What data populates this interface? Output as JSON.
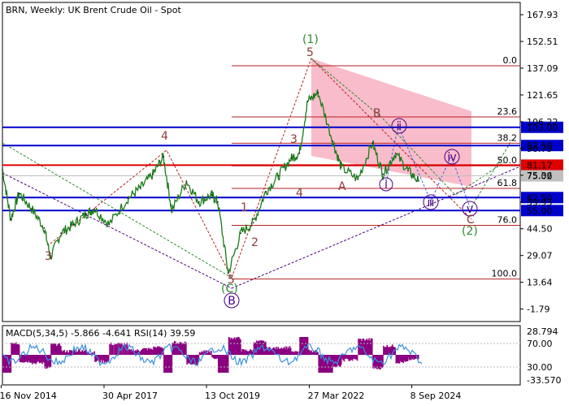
{
  "chart_data": [
    {
      "type": "line",
      "title": "BRN, Weekly:  UK Brent Crude Oil - Spot",
      "y_axis_ticks": [
        "167.93",
        "152.51",
        "137.09",
        "121.65",
        "106.22",
        "90.79",
        "75.36",
        "59.93",
        "44.50",
        "29.07",
        "13.64",
        "-1.79"
      ],
      "x_axis_ticks": [
        "16 Nov 2014",
        "30 Apr 2017",
        "13 Oct 2019",
        "27 Mar 2022",
        "8 Sep 2024"
      ],
      "ylim": [
        -9,
        175
      ],
      "series": [
        {
          "values": [
            [
              2014.9,
              79
            ],
            [
              2015.1,
              50
            ],
            [
              2015.3,
              65
            ],
            [
              2015.6,
              56
            ],
            [
              2015.9,
              45
            ],
            [
              2016.05,
              28
            ],
            [
              2016.3,
              42
            ],
            [
              2016.6,
              47
            ],
            [
              2016.9,
              53
            ],
            [
              2017.1,
              56
            ],
            [
              2017.45,
              47
            ],
            [
              2017.9,
              62
            ],
            [
              2018.2,
              68
            ],
            [
              2018.5,
              76
            ],
            [
              2018.75,
              86
            ],
            [
              2018.95,
              55
            ],
            [
              2019.3,
              72
            ],
            [
              2019.6,
              60
            ],
            [
              2019.9,
              64
            ],
            [
              2020.05,
              60
            ],
            [
              2020.3,
              19
            ],
            [
              2020.6,
              42
            ],
            [
              2020.9,
              48
            ],
            [
              2021.2,
              66
            ],
            [
              2021.5,
              75
            ],
            [
              2021.8,
              85
            ],
            [
              2022.0,
              88
            ],
            [
              2022.2,
              118
            ],
            [
              2022.45,
              123
            ],
            [
              2022.8,
              95
            ],
            [
              2023.0,
              80
            ],
            [
              2023.4,
              73
            ],
            [
              2023.75,
              94
            ],
            [
              2024.0,
              76
            ],
            [
              2024.3,
              88
            ],
            [
              2024.6,
              78
            ],
            [
              2024.85,
              72
            ]
          ]
        }
      ],
      "horizontal_levels": [
        {
          "label": "103.00",
          "value": 103.0,
          "color": "#0000cc"
        },
        {
          "label": "92.50",
          "value": 92.5,
          "color": "#0000cc"
        },
        {
          "label": "81.17",
          "value": 81.17,
          "color": "#e00000"
        },
        {
          "label": "75.02",
          "value": 75.02,
          "color": "#c0c0c0"
        },
        {
          "label": "62.50",
          "value": 62.5,
          "color": "#0000cc"
        },
        {
          "label": "55.00",
          "value": 55.0,
          "color": "#0000cc"
        }
      ],
      "fibonacci_levels": [
        {
          "label": "0.0",
          "value": 138.5
        },
        {
          "label": "23.6",
          "value": 109.0
        },
        {
          "label": "38.2",
          "value": 93.8
        },
        {
          "label": "50.0",
          "value": 80.8
        },
        {
          "label": "61.8",
          "value": 67.8
        },
        {
          "label": "76.0",
          "value": 46.5
        },
        {
          "label": "100.0",
          "value": 15.5
        }
      ],
      "wave_labels": [
        "3",
        "4",
        "5",
        "(1)",
        "5",
        "B",
        "3",
        "4",
        "A",
        "1",
        "2",
        "ⅰ",
        "ⅱ",
        "ⅲ",
        "ⅳ",
        "ⅴ",
        "C",
        "(2)",
        "(C)",
        "B"
      ],
      "colors": {
        "price": "#1a7a1a",
        "channel_fill": "#f7a6b8",
        "fib": "#b22222",
        "blue_level": "#0000cc",
        "red_level": "#e00000",
        "wave_brown": "#8b3a3a",
        "wave_green": "#2e8b2e",
        "wave_purple": "#4b0082"
      }
    },
    {
      "type": "area",
      "title": "MACD(5,34,5) -5.866 -4.641 RSI(14) 39.59",
      "y_axis_ticks": [
        "28.794",
        "70.00",
        "30.00",
        "-33.570"
      ],
      "colors": {
        "histogram": "#8b0080",
        "rsi": "#3a8fe0"
      }
    }
  ]
}
